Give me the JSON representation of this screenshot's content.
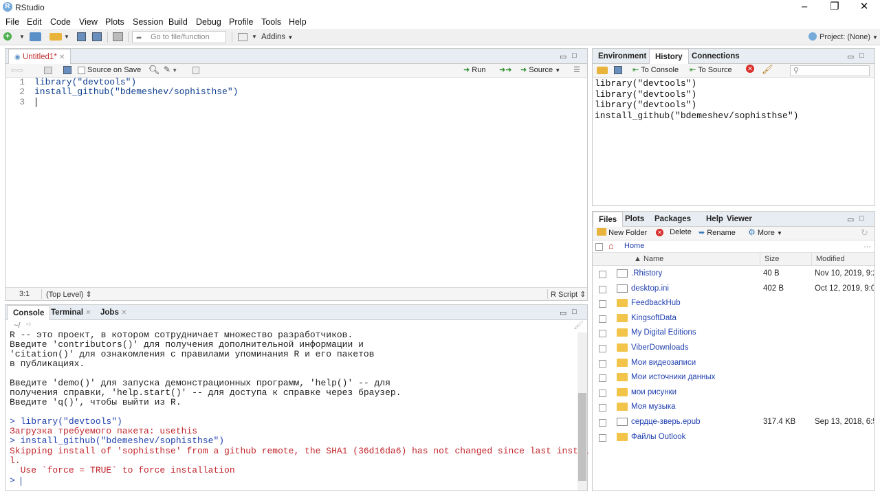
{
  "window": {
    "title": "RStudio",
    "minimize": "–",
    "maximize": "❐",
    "close": "✕"
  },
  "menu": [
    "File",
    "Edit",
    "Code",
    "View",
    "Plots",
    "Session",
    "Build",
    "Debug",
    "Profile",
    "Tools",
    "Help"
  ],
  "toolbar": {
    "goto_placeholder": "Go to file/function",
    "addins": "Addins",
    "project": "Project: (None)"
  },
  "editor": {
    "tab": "Untitled1*",
    "source_on_save": "Source on Save",
    "run": "Run",
    "source": "Source",
    "lines": [
      "library(\"devtools\")",
      "install_github(\"bdemeshev/sophisthse\")",
      ""
    ],
    "line_numbers": [
      "1",
      "2",
      "3"
    ],
    "status_pos": "3:1",
    "status_scope": "(Top Level) ⇕",
    "status_type": "R Script ⇕"
  },
  "console": {
    "tabs": [
      "Console",
      "Terminal",
      "Jobs"
    ],
    "path": "~/",
    "lines": [
      {
        "text": "R -- это проект, в котором сотрудничает множество разработчиков.",
        "color": "black"
      },
      {
        "text": "Введите 'contributors()' для получения дополнительной информации и",
        "color": "black"
      },
      {
        "text": "'citation()' для ознакомления с правилами упоминания R и его пакетов",
        "color": "black"
      },
      {
        "text": "в публикациях.",
        "color": "black"
      },
      {
        "text": "",
        "color": "black"
      },
      {
        "text": "Введите 'demo()' для запуска демонстрационных программ, 'help()' -- для",
        "color": "black"
      },
      {
        "text": "получения справки, 'help.start()' -- для доступа к справке через браузер.",
        "color": "black"
      },
      {
        "text": "Введите 'q()', чтобы выйти из R.",
        "color": "black"
      },
      {
        "text": "",
        "color": "black"
      },
      {
        "text": "> library(\"devtools\")",
        "color": "blue"
      },
      {
        "text": "Загрузка требуемого пакета: usethis",
        "color": "red"
      },
      {
        "text": "> install_github(\"bdemeshev/sophisthse\")",
        "color": "blue"
      },
      {
        "text": "Skipping install of 'sophisthse' from a github remote, the SHA1 (36d16da6) has not changed since last instal",
        "color": "red"
      },
      {
        "text": "l.",
        "color": "red"
      },
      {
        "text": "  Use `force = TRUE` to force installation",
        "color": "red"
      },
      {
        "text": "> ",
        "color": "blue"
      }
    ]
  },
  "env": {
    "tabs": [
      "Environment",
      "History",
      "Connections"
    ],
    "to_console": "To Console",
    "to_source": "To Source",
    "history": [
      "library(\"devtools\")",
      "library(\"devtools\")",
      "library(\"devtools\")",
      "install_github(\"bdemeshev/sophisthse\")"
    ]
  },
  "files": {
    "tabs": [
      "Files",
      "Plots",
      "Packages",
      "Help",
      "Viewer"
    ],
    "new_folder": "New Folder",
    "delete": "Delete",
    "rename": "Rename",
    "more": "More",
    "home": "Home",
    "col_name": "▲ Name",
    "col_size": "Size",
    "col_modified": "Modified",
    "rows": [
      {
        "name": ".Rhistory",
        "size": "40 B",
        "modified": "Nov 10, 2019, 9:2",
        "type": "file"
      },
      {
        "name": "desktop.ini",
        "size": "402 B",
        "modified": "Oct 12, 2019, 9:0",
        "type": "file"
      },
      {
        "name": "FeedbackHub",
        "size": "",
        "modified": "",
        "type": "folder"
      },
      {
        "name": "KingsoftData",
        "size": "",
        "modified": "",
        "type": "folder"
      },
      {
        "name": "My Digital Editions",
        "size": "",
        "modified": "",
        "type": "folder"
      },
      {
        "name": "ViberDownloads",
        "size": "",
        "modified": "",
        "type": "folder"
      },
      {
        "name": "Мои видеозаписи",
        "size": "",
        "modified": "",
        "type": "folder"
      },
      {
        "name": "Мои источники данных",
        "size": "",
        "modified": "",
        "type": "folder"
      },
      {
        "name": "мои рисунки",
        "size": "",
        "modified": "",
        "type": "folder"
      },
      {
        "name": "Моя музыка",
        "size": "",
        "modified": "",
        "type": "folder"
      },
      {
        "name": "сердце-зверь.epub",
        "size": "317.4 KB",
        "modified": "Sep 13, 2018, 6:5",
        "type": "file"
      },
      {
        "name": "Файлы Outlook",
        "size": "",
        "modified": "",
        "type": "folder"
      }
    ]
  }
}
